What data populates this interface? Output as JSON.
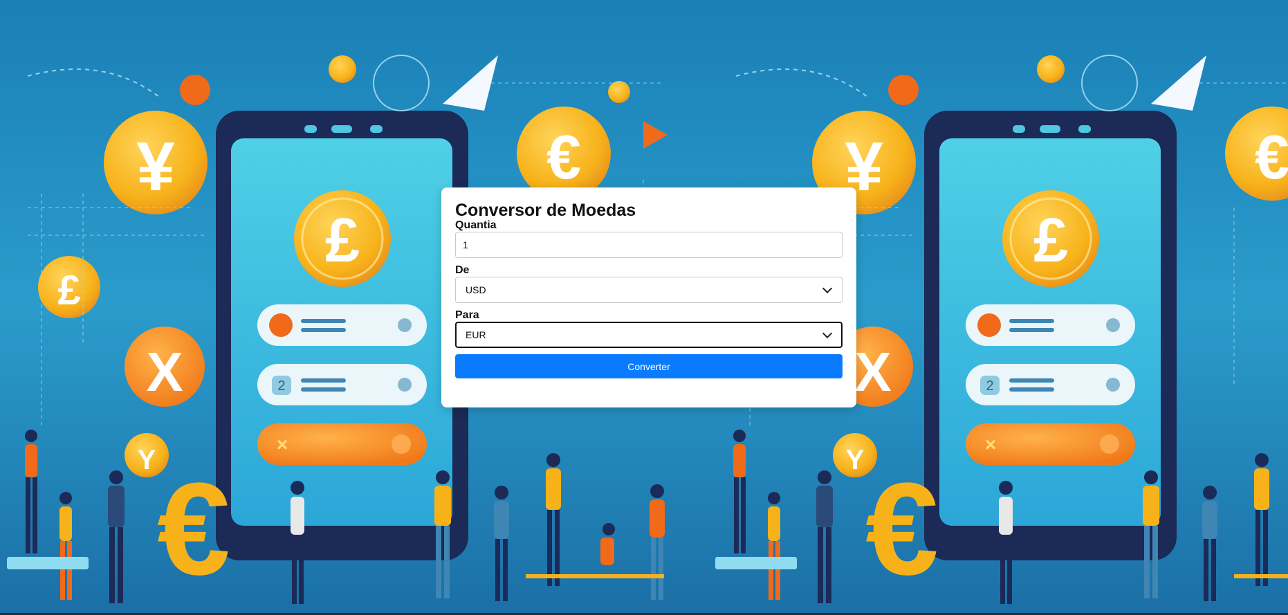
{
  "form": {
    "title": "Conversor de Moedas",
    "amount_label": "Quantia",
    "amount_value": "1",
    "from_label": "De",
    "from_value": "USD",
    "to_label": "Para",
    "to_value": "EUR",
    "convert_label": "Converter"
  },
  "colors": {
    "button": "#0a7bff",
    "background": "#1f8fc0",
    "coin": "#f7b21a",
    "accent_orange": "#f07a1a"
  }
}
